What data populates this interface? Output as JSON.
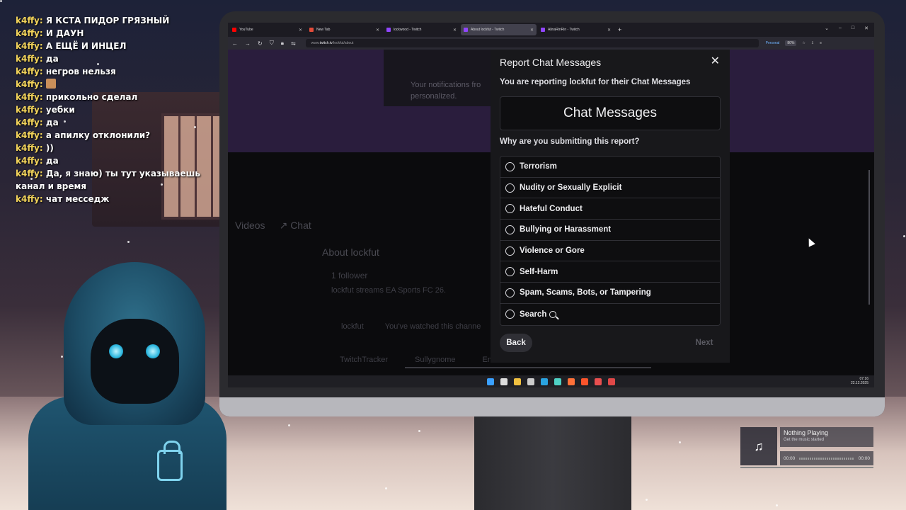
{
  "chat": [
    {
      "user": "k4ffy",
      "sep": ":",
      "text": "Я КСТА ПИДОР ГРЯЗНЫЙ"
    },
    {
      "user": "k4ffy",
      "sep": ":",
      "text": "И ДАУН"
    },
    {
      "user": "k4ffy",
      "sep": ":",
      "text": "А ЕЩЁ И ИНЦЕЛ"
    },
    {
      "user": "k4ffy",
      "sep": ":",
      "text": "да"
    },
    {
      "user": "k4ffy",
      "sep": ":",
      "text": "негров нельзя"
    },
    {
      "user": "k4ffy",
      "sep": ":",
      "text": ""
    },
    {
      "user": "k4ffy",
      "sep": ":",
      "text": "прикольно сделал"
    },
    {
      "user": "k4ffy",
      "sep": ":",
      "text": "уебки"
    },
    {
      "user": "k4ffy",
      "sep": ":",
      "text": "да"
    },
    {
      "user": "k4ffy",
      "sep": ":",
      "text": "а апилку отклонили?"
    },
    {
      "user": "k4ffy",
      "sep": ":",
      "text": "))"
    },
    {
      "user": "k4ffy",
      "sep": ":",
      "text": "да"
    },
    {
      "user": "k4ffy",
      "sep": ":",
      "text": "Да, я знаю) ты тут указываешь"
    },
    {
      "user": "",
      "sep": "",
      "text": "канал и время"
    },
    {
      "user": "k4ffy",
      "sep": ":",
      "text": "чат месседж"
    }
  ],
  "browser": {
    "tabs": [
      {
        "label": "YouTube",
        "color": "#ff0000",
        "active": false
      },
      {
        "label": "New Tab",
        "color": "#e34c3a",
        "active": false
      },
      {
        "label": "lockwood - Twitch",
        "color": "#9146ff",
        "active": false
      },
      {
        "label": "About lockfut - Twitch",
        "color": "#9146ff",
        "active": true
      },
      {
        "label": "AlinaRinRin - Twitch",
        "color": "#9146ff",
        "active": false
      }
    ],
    "url_prefix": "www.",
    "url_domain": "twitch.tv",
    "url_path": "/lockfut/about",
    "profile": "Personal",
    "zoom": "80%"
  },
  "page": {
    "notification_text": "Your notifications fro personalized.",
    "tab_videos": "Videos",
    "tab_chat": "Chat",
    "about_title": "About lockfut",
    "followers_count": "1",
    "followers_label": "follower",
    "description": "lockfut streams EA Sports FC 26.",
    "footer_channel": "lockfut",
    "footer_note": "You've watched this channe",
    "links": [
      "TwitchTracker",
      "Sullygnome",
      "Emotes"
    ]
  },
  "modal": {
    "title": "Report Chat Messages",
    "subtitle": "You are reporting lockfut for their Chat Messages",
    "category": "Chat Messages",
    "question": "Why are you submitting this report?",
    "options": [
      "Terrorism",
      "Nudity or Sexually Explicit",
      "Hateful Conduct",
      "Bullying or Harassment",
      "Violence or Gore",
      "Self-Harm",
      "Spam, Scams, Bots, or Tampering",
      "Search"
    ],
    "back_label": "Back",
    "next_label": "Next"
  },
  "taskbar": {
    "time": "07:16",
    "date": "22.12.2025",
    "icons": [
      "windows-icon",
      "search-icon",
      "folder-icon",
      "terminal-icon",
      "telegram-icon",
      "app-icon",
      "firefox-icon",
      "brave-icon",
      "store-icon",
      "steam-icon"
    ]
  },
  "music": {
    "title": "Nothing Playing",
    "subtitle": "Get the music started",
    "time_start": "00:00",
    "time_end": "00:00"
  }
}
